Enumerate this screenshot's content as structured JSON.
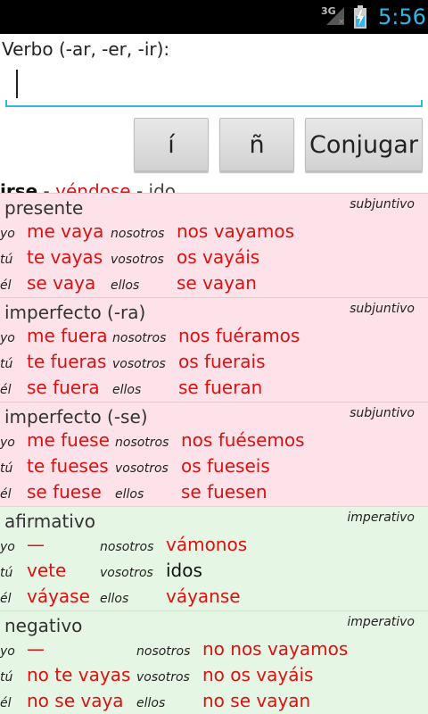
{
  "status_bar": {
    "network": "3G",
    "time": "5:56",
    "icons": [
      "signal-icon",
      "battery-charging-icon"
    ]
  },
  "form": {
    "label": "Verbo (-ar, -er, -ir):",
    "input_value": "",
    "buttons": [
      "í",
      "ñ",
      "Conjugar"
    ]
  },
  "summary": {
    "infinitive": "irse",
    "sep1": " - ",
    "gerund": "yéndose",
    "sep2": " - ",
    "participle": "ido"
  },
  "colors": {
    "accent": "#33b5e5",
    "irregular_form": "#dd1111",
    "subjunctive_bg": "#fde2e9",
    "imperative_bg": "#e6f6e4"
  },
  "sections": [
    {
      "tense": "presente",
      "mood": "subjuntivo",
      "rows": [
        {
          "p1": "yo",
          "f1": "me vaya",
          "p2": "nosotros",
          "f2": "nos vayamos"
        },
        {
          "p1": "tú",
          "f1": "te vayas",
          "p2": "vosotros",
          "f2": "os vayáis"
        },
        {
          "p1": "él",
          "f1": "se vaya",
          "p2": "ellos",
          "f2": "se vayan"
        }
      ]
    },
    {
      "tense": "imperfecto (-ra)",
      "mood": "subjuntivo",
      "rows": [
        {
          "p1": "yo",
          "f1": "me fuera",
          "p2": "nosotros",
          "f2": "nos fuéramos"
        },
        {
          "p1": "tú",
          "f1": "te fueras",
          "p2": "vosotros",
          "f2": "os fuerais"
        },
        {
          "p1": "él",
          "f1": "se fuera",
          "p2": "ellos",
          "f2": "se fueran"
        }
      ]
    },
    {
      "tense": "imperfecto (-se)",
      "mood": "subjuntivo",
      "rows": [
        {
          "p1": "yo",
          "f1": "me fuese",
          "p2": "nosotros",
          "f2": "nos fuésemos"
        },
        {
          "p1": "tú",
          "f1": "te fueses",
          "p2": "vosotros",
          "f2": "os fueseis"
        },
        {
          "p1": "él",
          "f1": "se fuese",
          "p2": "ellos",
          "f2": "se fuesen"
        }
      ]
    },
    {
      "tense": "afirmativo",
      "mood": "imperativo",
      "rows": [
        {
          "p1": "yo",
          "f1": "—",
          "p2": "nosotros",
          "f2": "vámonos"
        },
        {
          "p1": "tú",
          "f1": "vete",
          "p2": "vosotros",
          "f2": "idos"
        },
        {
          "p1": "él",
          "f1": "váyase",
          "p2": "ellos",
          "f2": "váyanse"
        }
      ]
    },
    {
      "tense": "negativo",
      "mood": "imperativo",
      "rows": [
        {
          "p1": "yo",
          "f1": "—",
          "p2": "nosotros",
          "f2": "no nos vayamos"
        },
        {
          "p1": "tú",
          "f1": "no te vayas",
          "p2": "vosotros",
          "f2": "no os vayáis"
        },
        {
          "p1": "él",
          "f1": "no se vaya",
          "p2": "ellos",
          "f2": "no se vayan"
        }
      ]
    }
  ]
}
